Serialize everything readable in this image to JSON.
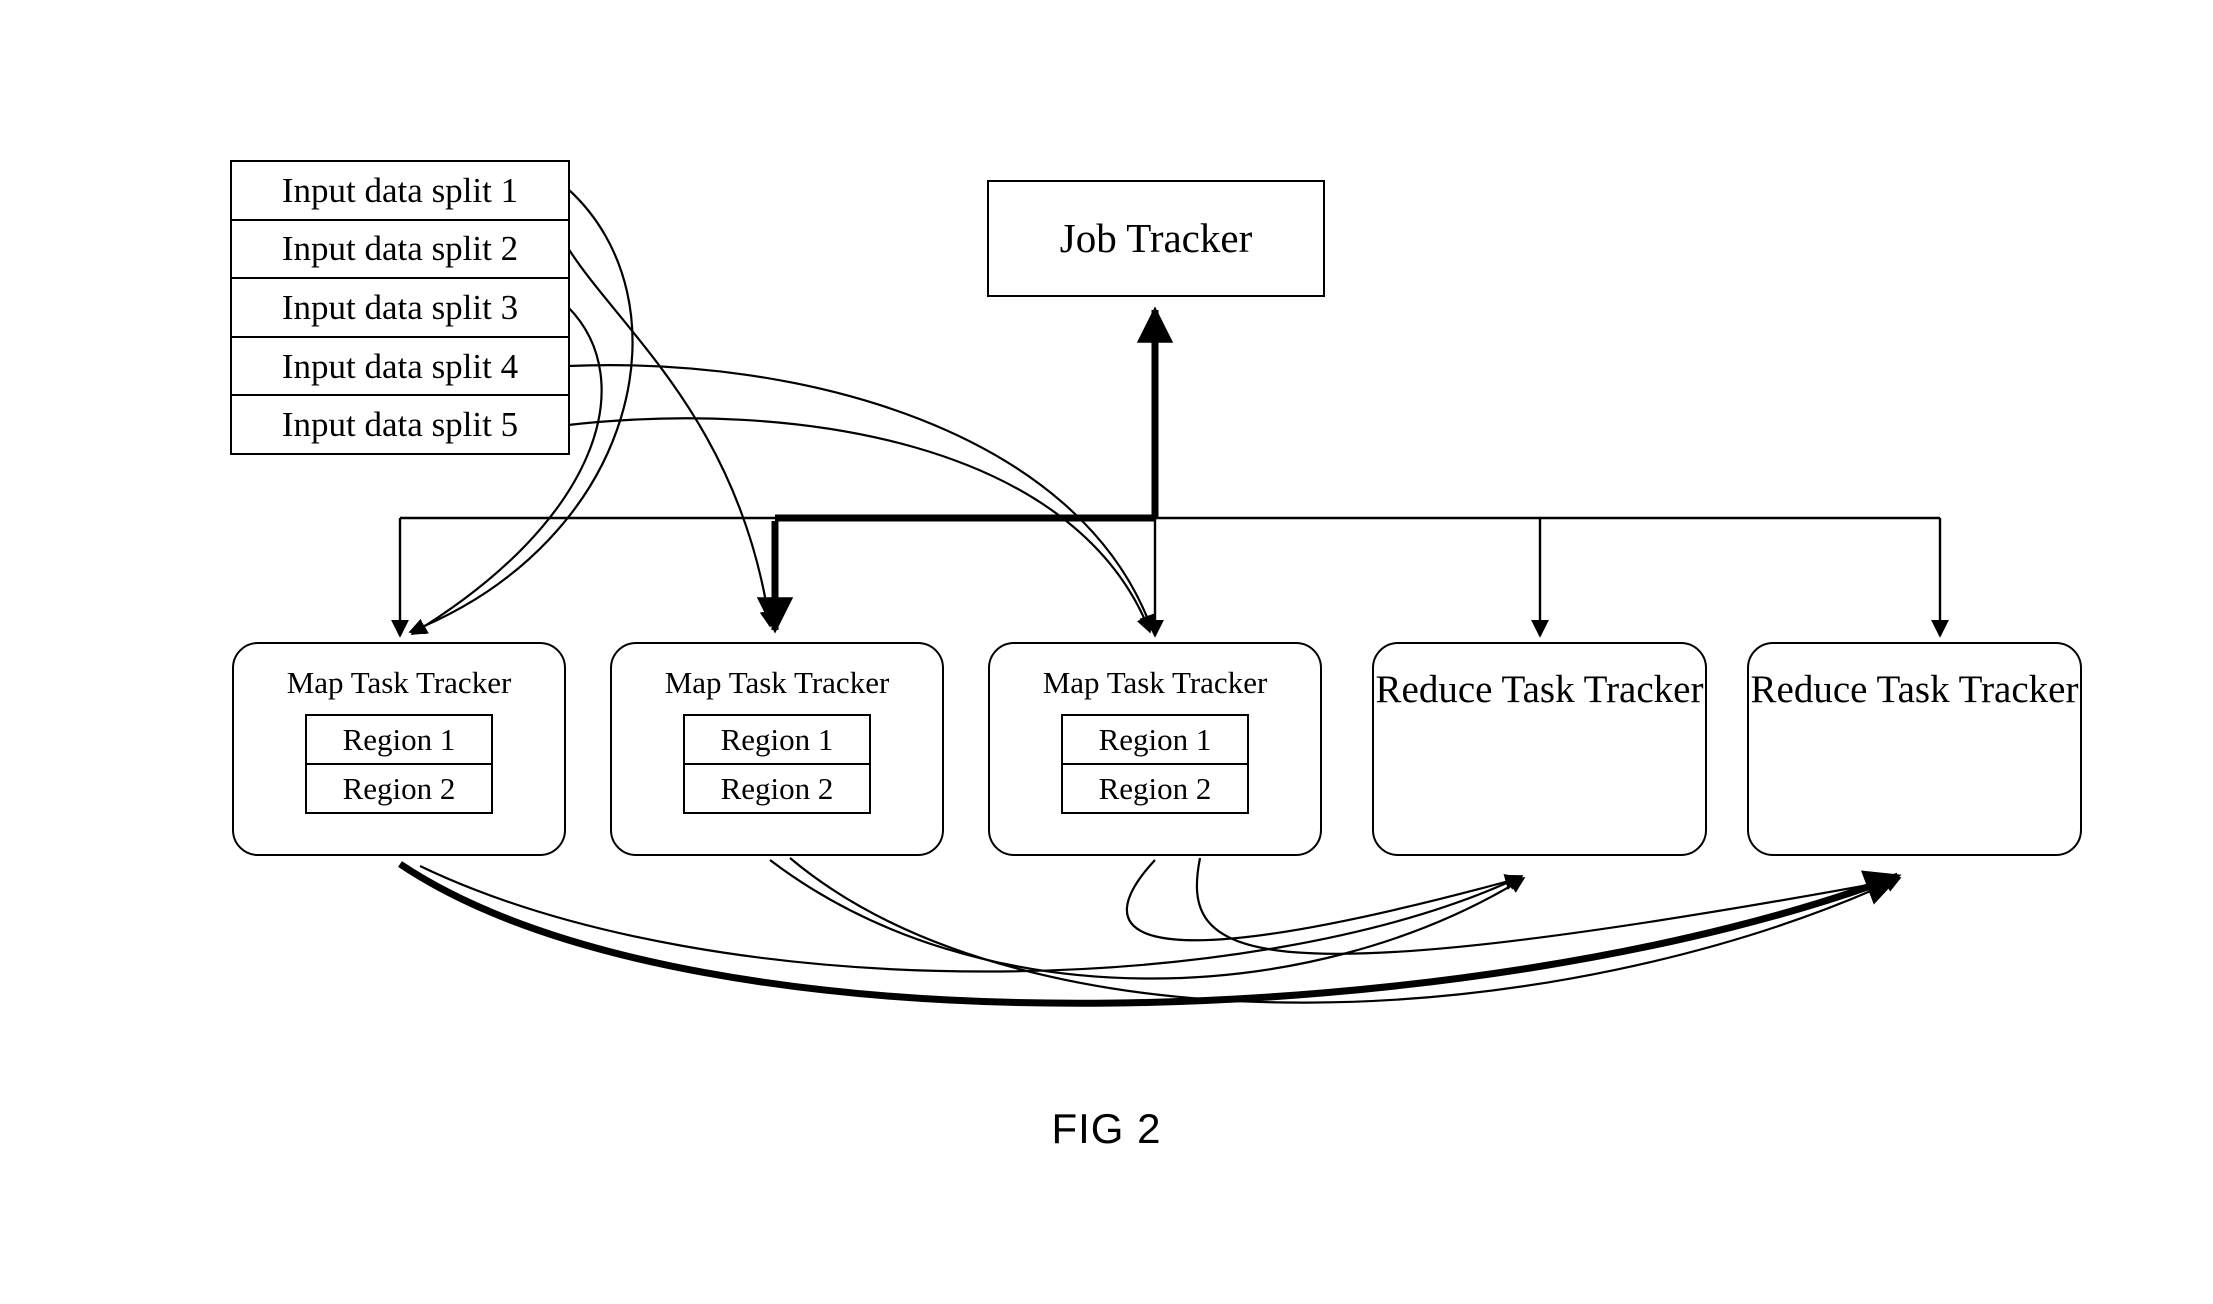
{
  "figure": {
    "caption": "FIG 2",
    "colors": {
      "stroke": "#000000",
      "background": "#ffffff",
      "text": "#000000"
    }
  },
  "input_splits": {
    "name": "input-data-splits",
    "items": [
      {
        "label": "Input data split 1"
      },
      {
        "label": "Input data split 2"
      },
      {
        "label": "Input data split 3"
      },
      {
        "label": "Input data split 4"
      },
      {
        "label": "Input data split 5"
      }
    ]
  },
  "job_tracker": {
    "label": "Job Tracker"
  },
  "trackers": [
    {
      "id": "map-1",
      "type": "map",
      "label": "Map Task Tracker",
      "regions": [
        {
          "label": "Region 1"
        },
        {
          "label": "Region 2"
        }
      ]
    },
    {
      "id": "map-2",
      "type": "map",
      "label": "Map Task Tracker",
      "regions": [
        {
          "label": "Region 1"
        },
        {
          "label": "Region 2"
        }
      ]
    },
    {
      "id": "map-3",
      "type": "map",
      "label": "Map Task Tracker",
      "regions": [
        {
          "label": "Region 1"
        },
        {
          "label": "Region 2"
        }
      ]
    },
    {
      "id": "reduce-1",
      "type": "reduce",
      "label": "Reduce Task Tracker",
      "regions": []
    },
    {
      "id": "reduce-2",
      "type": "reduce",
      "label": "Reduce Task Tracker",
      "regions": []
    }
  ],
  "chart_data": {
    "type": "diagram",
    "title": "FIG 2",
    "nodes": [
      {
        "id": "split-1",
        "label": "Input data split 1",
        "shape": "rect"
      },
      {
        "id": "split-2",
        "label": "Input data split 2",
        "shape": "rect"
      },
      {
        "id": "split-3",
        "label": "Input data split 3",
        "shape": "rect"
      },
      {
        "id": "split-4",
        "label": "Input data split 4",
        "shape": "rect"
      },
      {
        "id": "split-5",
        "label": "Input data split 5",
        "shape": "rect"
      },
      {
        "id": "job-tracker",
        "label": "Job Tracker",
        "shape": "rect"
      },
      {
        "id": "map-1",
        "label": "Map Task Tracker",
        "shape": "rounded-rect"
      },
      {
        "id": "map-2",
        "label": "Map Task Tracker",
        "shape": "rounded-rect"
      },
      {
        "id": "map-3",
        "label": "Map Task Tracker",
        "shape": "rounded-rect"
      },
      {
        "id": "reduce-1",
        "label": "Reduce Task Tracker",
        "shape": "rounded-rect"
      },
      {
        "id": "reduce-2",
        "label": "Reduce Task Tracker",
        "shape": "rounded-rect"
      }
    ],
    "edges": [
      {
        "from": "split-1",
        "to": "map-1",
        "style": "curved-arrow"
      },
      {
        "from": "split-3",
        "to": "map-1",
        "style": "curved-arrow"
      },
      {
        "from": "split-2",
        "to": "map-2",
        "style": "curved-arrow"
      },
      {
        "from": "split-4",
        "to": "map-3",
        "style": "curved-arrow"
      },
      {
        "from": "split-5",
        "to": "map-3",
        "style": "curved-arrow"
      },
      {
        "from": "bus",
        "to": "map-1",
        "style": "straight-arrow"
      },
      {
        "from": "bus",
        "to": "map-2",
        "style": "straight-arrow-bold"
      },
      {
        "from": "bus",
        "to": "map-3",
        "style": "straight-arrow"
      },
      {
        "from": "bus",
        "to": "reduce-1",
        "style": "straight-arrow"
      },
      {
        "from": "bus",
        "to": "reduce-2",
        "style": "straight-arrow"
      },
      {
        "from": "bus",
        "to": "job-tracker",
        "style": "straight-arrow-bold"
      },
      {
        "from": "map-1",
        "to": "reduce-2",
        "style": "curved-arrow-bold"
      },
      {
        "from": "map-1",
        "to": "reduce-1",
        "style": "curved-arrow"
      },
      {
        "from": "map-2",
        "to": "reduce-1",
        "style": "curved-arrow"
      },
      {
        "from": "map-2",
        "to": "reduce-2",
        "style": "curved-arrow"
      },
      {
        "from": "map-3",
        "to": "reduce-1",
        "style": "curved-arrow"
      },
      {
        "from": "map-3",
        "to": "reduce-2",
        "style": "curved-arrow"
      }
    ]
  }
}
